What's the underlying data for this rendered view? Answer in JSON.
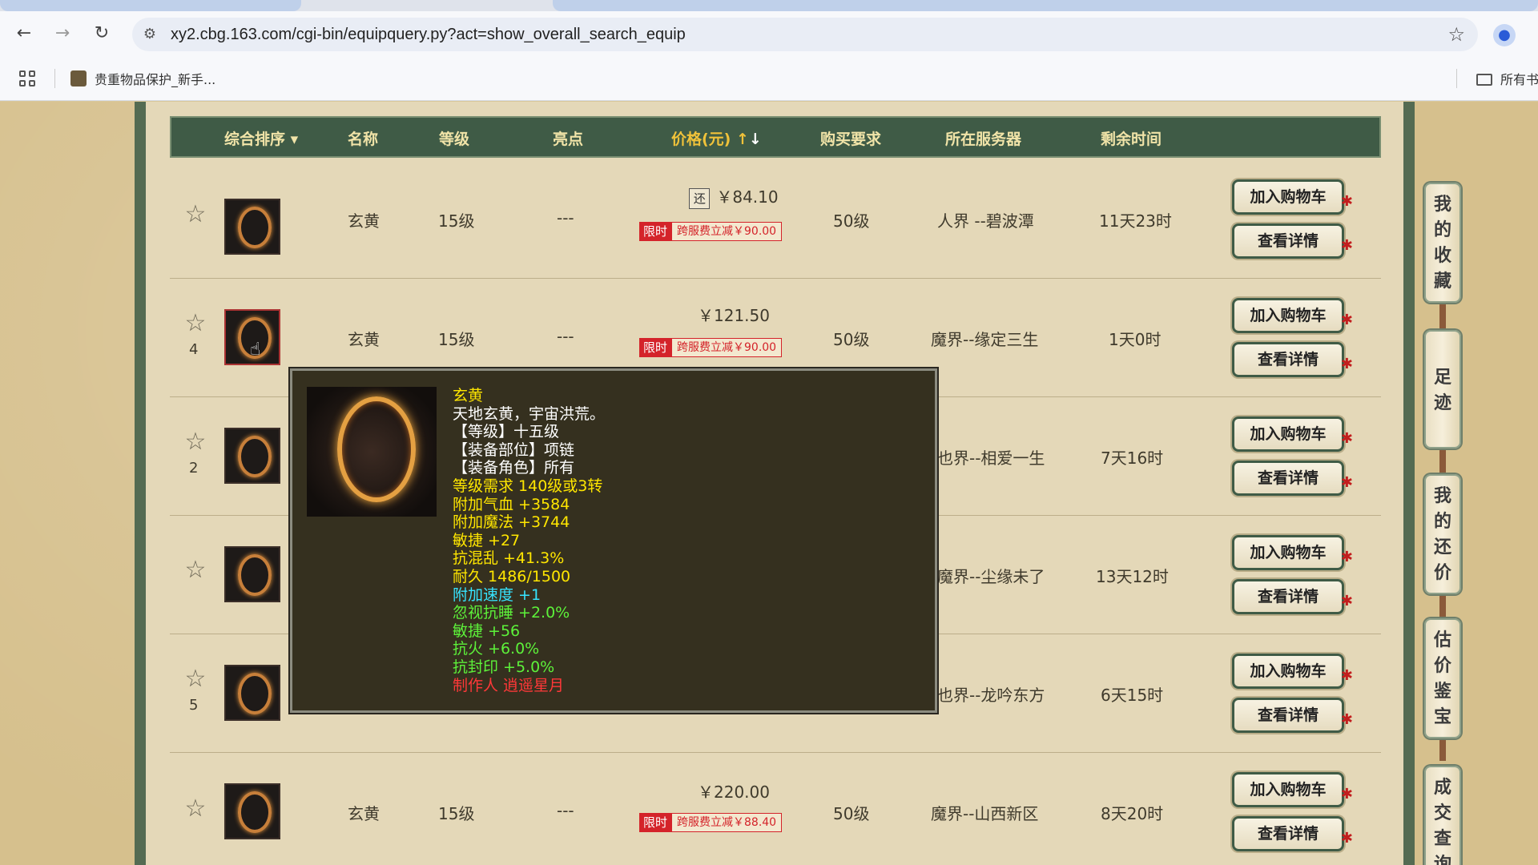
{
  "browser": {
    "url": "xy2.cbg.163.com/cgi-bin/equipquery.py?act=show_overall_search_equip",
    "bookmark": "贵重物品保护_新手...",
    "bookmark_right": "所有书"
  },
  "table": {
    "headers": {
      "sort": "综合排序",
      "name": "名称",
      "level": "等级",
      "highlight": "亮点",
      "price": "价格(元)",
      "requirement": "购买要求",
      "server": "所在服务器",
      "time": "剩余时间"
    },
    "add_cart_label": "加入购物车",
    "detail_label": "查看详情",
    "promo_tag": "限时",
    "rows": [
      {
        "fav": "",
        "name": "玄黄",
        "level": "15级",
        "highlight": "---",
        "price": "￥84.10",
        "rebate": "还",
        "promo": "跨服费立减￥90.00",
        "req": "50级",
        "server": "人界 --碧波潭",
        "time": "11天23时"
      },
      {
        "fav": "4",
        "name": "玄黄",
        "level": "15级",
        "highlight": "---",
        "price": "￥121.50",
        "rebate": "",
        "promo": "跨服费立减￥90.00",
        "req": "50级",
        "server": "魔界--缘定三生",
        "time": "1天0时"
      },
      {
        "fav": "2",
        "name": "",
        "level": "",
        "highlight": "",
        "price": "",
        "rebate": "",
        "promo": "",
        "req": "",
        "server": "也界--相爱一生",
        "time": "7天16时"
      },
      {
        "fav": "",
        "name": "",
        "level": "",
        "highlight": "",
        "price": "",
        "rebate": "",
        "promo": "",
        "req": "",
        "server": "魔界--尘缘未了",
        "time": "13天12时"
      },
      {
        "fav": "5",
        "name": "",
        "level": "",
        "highlight": "",
        "price": "",
        "rebate": "",
        "promo": "",
        "req": "",
        "server": "也界--龙吟东方",
        "time": "6天15时"
      },
      {
        "fav": "",
        "name": "玄黄",
        "level": "15级",
        "highlight": "---",
        "price": "￥220.00",
        "rebate": "",
        "promo": "跨服费立减￥88.40",
        "req": "50级",
        "server": "魔界--山西新区",
        "time": "8天20时"
      }
    ]
  },
  "tooltip": {
    "lines": [
      {
        "text": "玄黄",
        "color": "yellow"
      },
      {
        "text": "天地玄黄，宇宙洪荒。",
        "color": "white"
      },
      {
        "text": "【等级】十五级",
        "color": "white"
      },
      {
        "text": "【装备部位】项链",
        "color": "white"
      },
      {
        "text": "【装备角色】所有",
        "color": "white"
      },
      {
        "text": "等级需求 140级或3转",
        "color": "yellow"
      },
      {
        "text": "附加气血 +3584",
        "color": "yellow"
      },
      {
        "text": "附加魔法 +3744",
        "color": "yellow"
      },
      {
        "text": "敏捷 +27",
        "color": "yellow"
      },
      {
        "text": "抗混乱 +41.3%",
        "color": "yellow"
      },
      {
        "text": "耐久 1486/1500",
        "color": "yellow"
      },
      {
        "text": "附加速度 +1",
        "color": "cyan"
      },
      {
        "text": "忽视抗睡 +2.0%",
        "color": "green"
      },
      {
        "text": "敏捷 +56",
        "color": "green"
      },
      {
        "text": "抗火 +6.0%",
        "color": "green"
      },
      {
        "text": "抗封印 +5.0%",
        "color": "green"
      },
      {
        "text": "制作人 逍遥星月",
        "color": "red"
      }
    ]
  },
  "side": {
    "favorites": "我的收藏",
    "footprint": "足迹",
    "my_offer": "我的还价",
    "appraise": "估价鉴宝",
    "deal_query": "成交查询"
  }
}
